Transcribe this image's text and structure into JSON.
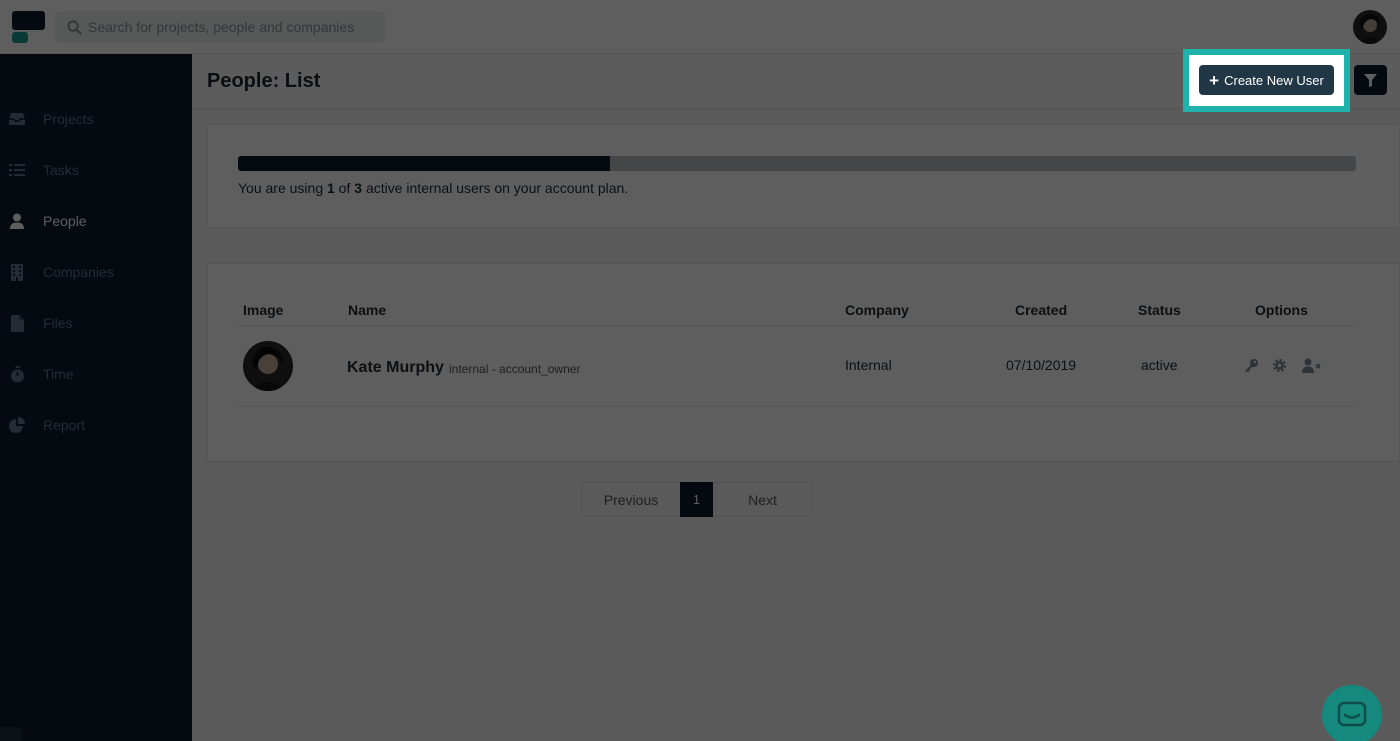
{
  "search": {
    "placeholder": "Search for projects, people and companies"
  },
  "sidebar": {
    "items": [
      {
        "label": "Projects",
        "icon": "inbox-icon"
      },
      {
        "label": "Tasks",
        "icon": "list-icon"
      },
      {
        "label": "People",
        "icon": "user-icon",
        "active": true
      },
      {
        "label": "Companies",
        "icon": "building-icon"
      },
      {
        "label": "Files",
        "icon": "file-icon"
      },
      {
        "label": "Time",
        "icon": "stopwatch-icon"
      },
      {
        "label": "Report",
        "icon": "pie-chart-icon"
      }
    ]
  },
  "page": {
    "title": "People: List",
    "create_label": "Create New User"
  },
  "usage": {
    "prefix": "You are using ",
    "used": "1",
    "of": " of ",
    "total": "3",
    "suffix": " active internal users on your account plan.",
    "fraction": 0.333
  },
  "table": {
    "headers": {
      "image": "Image",
      "name": "Name",
      "company": "Company",
      "created": "Created",
      "status": "Status",
      "options": "Options"
    },
    "rows": [
      {
        "name": "Kate Murphy",
        "role": "internal - account_owner",
        "company": "Internal",
        "created": "07/10/2019",
        "status": "active"
      }
    ]
  },
  "pagination": {
    "previous": "Previous",
    "current": "1",
    "next": "Next"
  },
  "colors": {
    "sidebar": "#0c1c2a",
    "accent": "#1fb2aa",
    "button": "#213746"
  }
}
